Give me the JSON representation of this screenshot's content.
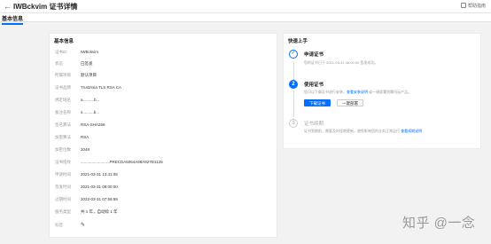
{
  "header": {
    "back_icon": "arrow-left-icon",
    "title": "IWBckvim 证书详情",
    "help_label": "帮助指南",
    "help_icon": "book-icon"
  },
  "tabs": [
    {
      "label": "基本信息",
      "active": true
    }
  ],
  "basic_info": {
    "title": "基本信息",
    "rows": [
      {
        "key": "证书ID",
        "value": "IWBckvim"
      },
      {
        "key": "状态",
        "value": "已签发"
      },
      {
        "key": "所属项目",
        "value": "默认项目"
      },
      {
        "key": "证书品牌",
        "value": "TrustAsia TLS RSA CA"
      },
      {
        "key": "绑定域名",
        "value": "a..........b..."
      },
      {
        "key": "备注名称",
        "value": "s..........b..."
      },
      {
        "key": "签名算法",
        "value": "RSA-SHA256"
      },
      {
        "key": "加密算法",
        "value": "RSA"
      },
      {
        "key": "加密位数",
        "value": "2048"
      },
      {
        "key": "证书指纹",
        "value": "..........................PRECDA5064A98A927D1125"
      },
      {
        "key": "申请时间",
        "value": "2021-03-31 13:41:08"
      },
      {
        "key": "签发时间",
        "value": "2021-03-31 08:00:00"
      },
      {
        "key": "过期时间",
        "value": "2022-03-31 07:59:59"
      },
      {
        "key": "服务类型",
        "value": "共 1 年，自动续 1 年"
      },
      {
        "key": "标签",
        "value": "✎"
      }
    ]
  },
  "quick_start": {
    "title": "快速上手",
    "steps": [
      {
        "number": "✓",
        "title": "申请证书",
        "desc": "您的证书已于 2021-03-31 08:00:00 签发成功。"
      },
      {
        "number": "2",
        "title": "使用证书",
        "desc_prefix": "您可以下载证书进行安装，",
        "desc_link": "查看安装说明",
        "desc_suffix": " 或一键部署到腾讯云产品。",
        "download_button": "下载证书",
        "deploy_button": "一键部署"
      },
      {
        "number": "3",
        "title": "证书续期",
        "desc_prefix": "证书到期前，需要及时续期更新，避免影响您的业务正常运行 ",
        "desc_link": "查看续期说明"
      }
    ]
  },
  "watermark": "知乎 @一念"
}
